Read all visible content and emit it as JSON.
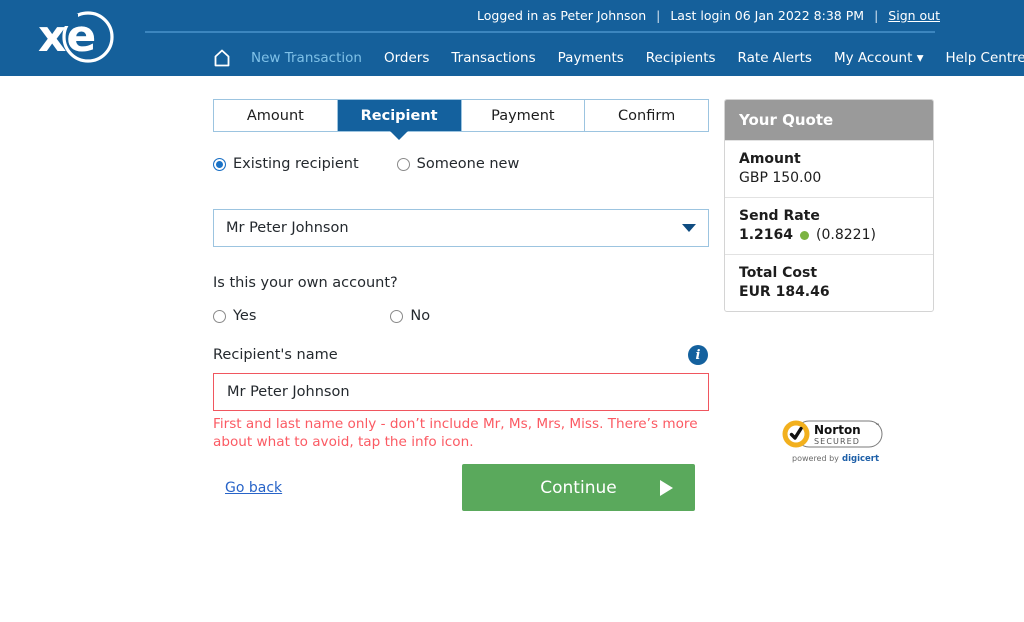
{
  "header": {
    "logo_alt": "xe",
    "logged_in_as": "Logged in as Peter Johnson",
    "last_login": "Last login 06 Jan 2022 8:38 PM",
    "sign_out": "Sign out",
    "separator": "|",
    "nav": [
      {
        "label": "New Transaction",
        "active": true
      },
      {
        "label": "Orders",
        "active": false
      },
      {
        "label": "Transactions",
        "active": false
      },
      {
        "label": "Payments",
        "active": false
      },
      {
        "label": "Recipients",
        "active": false
      },
      {
        "label": "Rate Alerts",
        "active": false
      },
      {
        "label": "My Account ▾",
        "active": false
      },
      {
        "label": "Help Centre",
        "active": false
      }
    ]
  },
  "steps": [
    {
      "label": "Amount",
      "active": false
    },
    {
      "label": "Recipient",
      "active": true
    },
    {
      "label": "Payment",
      "active": false
    },
    {
      "label": "Confirm",
      "active": false
    }
  ],
  "form": {
    "recipient_type": {
      "existing_label": "Existing recipient",
      "existing_selected": true,
      "new_label": "Someone new",
      "new_selected": false
    },
    "recipient_select": {
      "value": "Mr Peter Johnson"
    },
    "own_account": {
      "question": "Is this your own account?",
      "yes_label": "Yes",
      "yes_selected": false,
      "no_label": "No",
      "no_selected": false
    },
    "recipient_name": {
      "label": "Recipient's name",
      "value": "Mr Peter Johnson",
      "placeholder": "Recipient's name",
      "error": "First and last name only - don’t include Mr, Ms, Mrs, Miss. There’s more about what to avoid, tap the info icon.",
      "info_icon": "i"
    },
    "go_back": "Go back",
    "continue": "Continue"
  },
  "quote": {
    "title": "Your Quote",
    "rows": [
      {
        "key": "Amount",
        "value": "GBP 150.00",
        "bold": false
      },
      {
        "key": "Send Rate",
        "value": "1.2164",
        "inverse": "(0.8221)",
        "bold": true
      },
      {
        "key": "Total Cost",
        "value": "EUR 184.46",
        "bold": true
      }
    ]
  },
  "badge": {
    "brand": "Norton",
    "secured": "SECURED",
    "powered_prefix": "powered by",
    "powered_brand": "digicert"
  },
  "colors": {
    "header_blue": "#15609b",
    "active_tab_blue": "#14619e",
    "nav_active": "#7fc1e8",
    "error_red": "#fb5a63",
    "continue_green": "#5aa95c",
    "rate_dot_green": "#7cb342",
    "quote_header_gray": "#9a9a9a",
    "link_blue": "#2864c8"
  }
}
